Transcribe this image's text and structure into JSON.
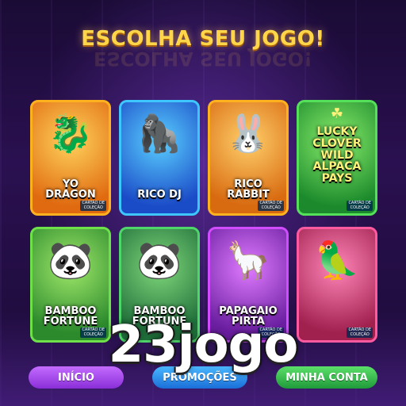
{
  "header": {
    "title": "ESCOLHA SEU JOGO!",
    "title_reflection": "ESCOLHA SEU JOGO!"
  },
  "games": [
    {
      "name": "YO\nDRAGON",
      "art_icon": "dragon-icon",
      "glyph": "🐉",
      "badge": ""
    },
    {
      "name": "RICO DJ",
      "art_icon": "gorilla-dj-icon",
      "glyph": "🦍",
      "badge": ""
    },
    {
      "name": "RICO\nRABBIT",
      "art_icon": "rabbit-icon",
      "glyph": "🐰",
      "badge": "CARTÃO DE\nCOLEÇÃO"
    },
    {
      "name": "LUCKY\nCLOVER\nWILD\nALPACA\nPAYS",
      "art_icon": "clover-icon",
      "glyph": "",
      "badge": "CARTÃO DE\nCOLEÇÃO"
    },
    {
      "name": "BAMBOO\nFORTUNE",
      "art_icon": "panda-icon",
      "glyph": "🐼",
      "badge": "CARTÃO DE\nCOLEÇÃO"
    },
    {
      "name": "BAMBOO\nFORTUNE",
      "art_icon": "panda-icon",
      "glyph": "🐼",
      "badge": ""
    },
    {
      "name": "PAPAGAIO\nPIRTA",
      "art_icon": "alpaca-icon",
      "glyph": "🦙",
      "badge": "CARTÃO DE\nCOLEÇÃO"
    },
    {
      "name": "",
      "art_icon": "parrot-treasure-icon",
      "glyph": "🦜",
      "badge": "CARTÃO DE\nCOLEÇÃO"
    }
  ],
  "first_card_badge": "CARTÃO DE\nCOLEÇÃO",
  "watermark": "23jogo",
  "nav": {
    "home": "INÍCIO",
    "promotions": "PROMOÇÕES",
    "account": "MINHA CONTA"
  },
  "colors": {
    "title": "#ffd54a",
    "bg": "#1a0b35",
    "home": "#b05cf0",
    "promotions": "#2f8ef0",
    "account": "#3fc454"
  }
}
